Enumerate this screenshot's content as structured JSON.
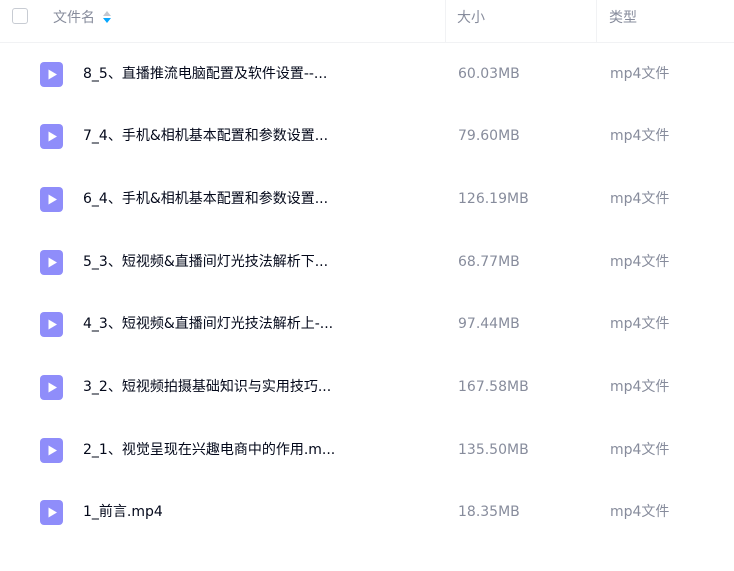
{
  "header": {
    "name_label": "文件名",
    "size_label": "大小",
    "type_label": "类型"
  },
  "colors": {
    "sort_active": "#06a7ff",
    "video_icon": "#8f8dfa"
  },
  "files": [
    {
      "name": "8_5、直播推流电脑配置及软件设置--...",
      "size": "60.03MB",
      "type": "mp4文件",
      "icon": "video-file-icon"
    },
    {
      "name": "7_4、手机&相机基本配置和参数设置...",
      "size": "79.60MB",
      "type": "mp4文件",
      "icon": "video-file-icon"
    },
    {
      "name": "6_4、手机&相机基本配置和参数设置...",
      "size": "126.19MB",
      "type": "mp4文件",
      "icon": "video-file-icon"
    },
    {
      "name": "5_3、短视频&直播间灯光技法解析下...",
      "size": "68.77MB",
      "type": "mp4文件",
      "icon": "video-file-icon"
    },
    {
      "name": "4_3、短视频&直播间灯光技法解析上-...",
      "size": "97.44MB",
      "type": "mp4文件",
      "icon": "video-file-icon"
    },
    {
      "name": "3_2、短视频拍摄基础知识与实用技巧...",
      "size": "167.58MB",
      "type": "mp4文件",
      "icon": "video-file-icon"
    },
    {
      "name": "2_1、视觉呈现在兴趣电商中的作用.m...",
      "size": "135.50MB",
      "type": "mp4文件",
      "icon": "video-file-icon"
    },
    {
      "name": "1_前言.mp4",
      "size": "18.35MB",
      "type": "mp4文件",
      "icon": "video-file-icon"
    }
  ]
}
